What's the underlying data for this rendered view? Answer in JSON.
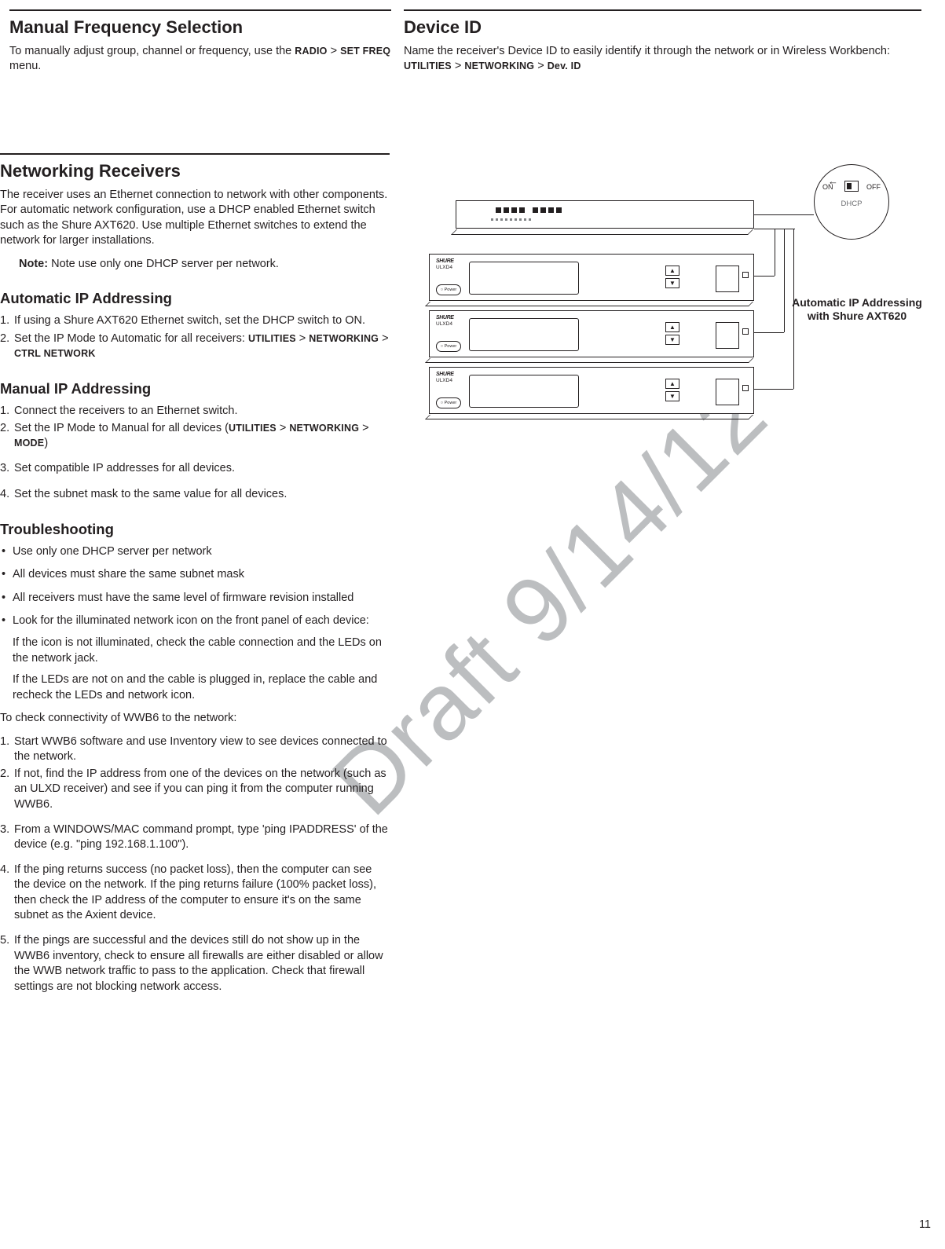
{
  "top": {
    "left": {
      "heading": "Manual Frequency Selection",
      "para_pre": "To manually adjust group, channel or frequency, use the ",
      "b1": "RADIO",
      "gt1": " > ",
      "b2": "SET FREQ",
      "para_post": " menu."
    },
    "right": {
      "heading": "Device ID",
      "para_pre": "Name the receiver's Device ID to easily identify it through the network or in Wireless Workbench: ",
      "b1": "UTILITIES",
      "gt1": " > ",
      "b2": "NETWORKING",
      "gt2": " > ",
      "b3": "Dev. ID"
    }
  },
  "net": {
    "heading": "Networking Receivers",
    "intro": "The receiver uses an Ethernet connection to network with other components. For automatic network configuration, use a DHCP enabled Ethernet switch such as the Shure AXT620. Use multiple Ethernet switches to extend the network for larger installations.",
    "note_label": "Note:",
    "note_text": " Note use only one DHCP server per network.",
    "auto_heading": "Automatic IP Addressing",
    "auto_items": [
      {
        "text": "If using a Shure AXT620 Ethernet switch, set the DHCP switch to ON."
      },
      {
        "pre": "Set the IP Mode to Automatic for all receivers: ",
        "b1": "UTILITIES",
        "gt1": " > ",
        "b2": "NETWORKING",
        "gt2": " > ",
        "b3": "CTRL NETWORK"
      }
    ],
    "man_heading": "Manual IP Addressing",
    "man_items": [
      {
        "text": "Connect the receivers to an Ethernet switch."
      },
      {
        "pre": "Set the IP Mode to Manual for all devices (",
        "b1": "UTILITIES",
        "gt1": " > ",
        "b2": "NETWORKING",
        "gt2": " > ",
        "b3": "MODE",
        "post": ")"
      },
      {
        "text": "Set compatible IP addresses for all devices."
      },
      {
        "text": "Set the subnet mask to the same value for all devices."
      }
    ],
    "ts_heading": "Troubleshooting",
    "ts_bullets": [
      {
        "text": "Use only one DHCP server per network"
      },
      {
        "text": "All devices must share the same subnet mask"
      },
      {
        "text": "All receivers must have the same level of firmware revision installed"
      },
      {
        "text": "Look for the illuminated network icon on the front panel of each device:",
        "sub1": "If the icon is not illuminated, check the cable connection and the LEDs on the network jack.",
        "sub2": "If the LEDs are not on and the cable is plugged in, replace the cable and recheck the LEDs and network icon."
      }
    ],
    "ts_intro2": "To check connectivity of WWB6 to the network:",
    "ts_steps": [
      "Start WWB6 software and use Inventory view to see devices connected to the network.",
      "If not, find the IP address from one of the devices on the network (such as an ULXD receiver) and see if you can ping it from the computer running WWB6.",
      "From a WINDOWS/MAC command prompt, type 'ping IPADDRESS' of the device (e.g. \"ping 192.168.1.100\").",
      "If the ping returns success (no packet loss), then the computer can see the device on the network. If the ping returns failure (100% packet loss), then check the IP address of the computer to ensure it's on the same subnet as the Axient device.",
      "If the pings are successful and the devices still do not show up in the WWB6 inventory, check to ensure all firewalls are either disabled or allow the WWB network traffic to pass to the application. Check that firewall settings are not blocking network access."
    ]
  },
  "diagram": {
    "caption": "Automatic IP Addressing with Shure AXT620",
    "dhcp_on": "ON",
    "dhcp_off": "OFF",
    "dhcp_label": "DHCP",
    "brand": "SHURE",
    "model": "ULXD4",
    "power": "○ Power"
  },
  "watermark": "Draft 9/14/12",
  "page_number": "11"
}
